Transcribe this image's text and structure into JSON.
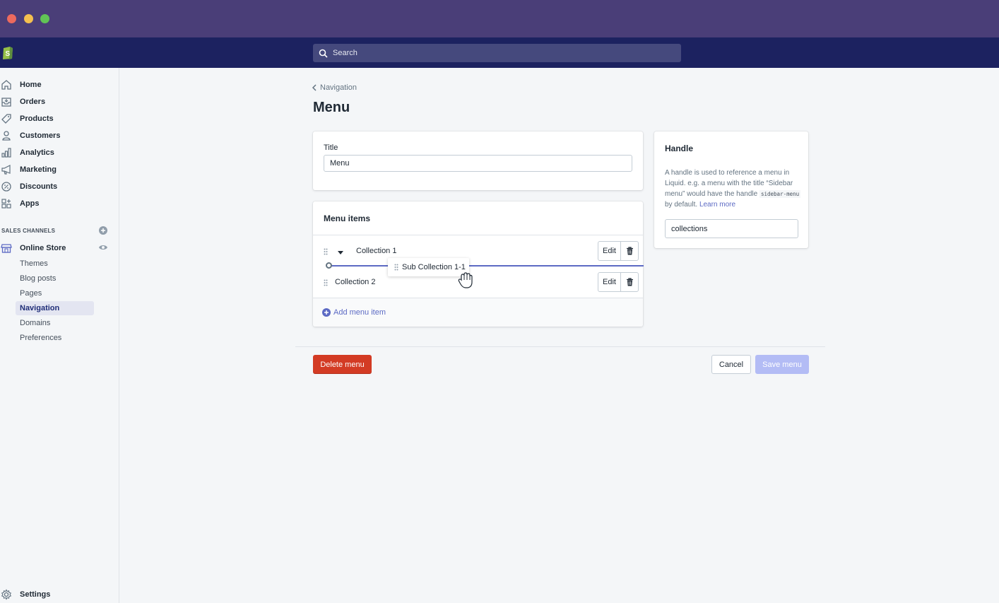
{
  "window": {
    "colors": {
      "titlebar": "#4a3e78",
      "topbar": "#1c2260"
    }
  },
  "topbar": {
    "search_placeholder": "Search"
  },
  "sidebar": {
    "items": [
      {
        "label": "Home",
        "icon": "home-icon"
      },
      {
        "label": "Orders",
        "icon": "orders-icon"
      },
      {
        "label": "Products",
        "icon": "tag-icon"
      },
      {
        "label": "Customers",
        "icon": "person-icon"
      },
      {
        "label": "Analytics",
        "icon": "bar-chart-icon"
      },
      {
        "label": "Marketing",
        "icon": "megaphone-icon"
      },
      {
        "label": "Discounts",
        "icon": "discount-icon"
      },
      {
        "label": "Apps",
        "icon": "apps-icon"
      }
    ],
    "sales_channels_header": "SALES CHANNELS",
    "online_store": "Online Store",
    "sub_items": [
      "Themes",
      "Blog posts",
      "Pages",
      "Navigation",
      "Domains",
      "Preferences"
    ],
    "active_sub_item": "Navigation",
    "settings": "Settings"
  },
  "main": {
    "breadcrumb": "Navigation",
    "title": "Menu",
    "title_card": {
      "label": "Title",
      "value": "Menu"
    },
    "menu_items": {
      "heading": "Menu items",
      "rows": [
        {
          "label": "Collection 1",
          "edit": "Edit"
        },
        {
          "label": "Collection 2",
          "edit": "Edit"
        }
      ],
      "dragging": "Sub Collection 1-1",
      "add": "Add menu item"
    },
    "handle": {
      "title": "Handle",
      "desc_part1": "A handle is used to reference a menu in Liquid. e.g. a menu with the title “Sidebar menu” would have the handle",
      "desc_code": "sidebar-menu",
      "desc_part2": "by default.",
      "learn_more": "Learn more",
      "value": "collections"
    },
    "actions": {
      "delete": "Delete menu",
      "cancel": "Cancel",
      "save": "Save menu"
    }
  }
}
